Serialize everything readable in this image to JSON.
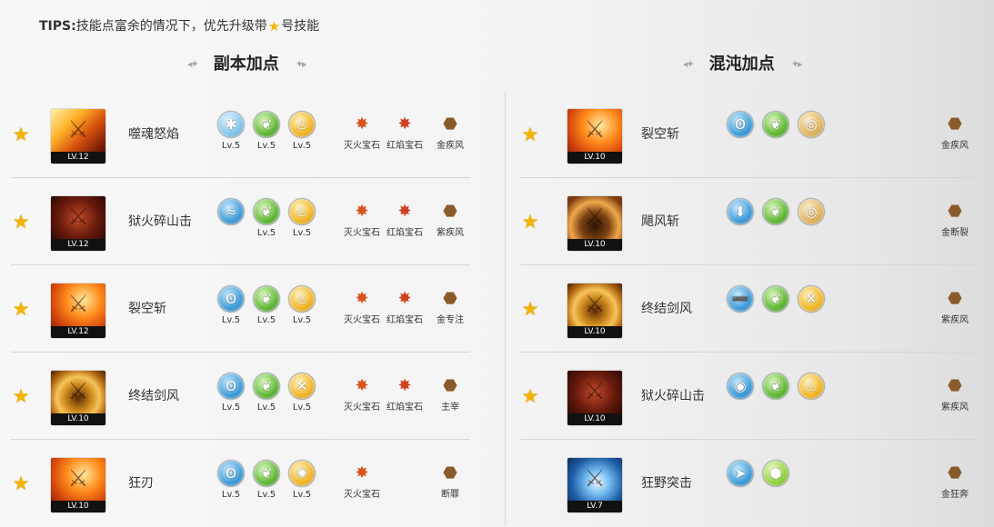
{
  "tips": {
    "prefix": "TIPS:",
    "text_before_star": "技能点富余的情况下，优先升级带",
    "star_icon": "star-icon",
    "text_after_star": "号技能"
  },
  "sections": {
    "left": {
      "title": "副本加点",
      "ornament": "◂⟡"
    },
    "right": {
      "title": "混沌加点",
      "ornament": "⟡▸"
    }
  },
  "left_rows": [
    {
      "starred": true,
      "skill_name": "噬魂怒焰",
      "level": "LV.12",
      "runes": [
        {
          "icon": "frost-rune-icon",
          "caption": "Lv.5"
        },
        {
          "icon": "leaf-rune-icon",
          "caption": "Lv.5"
        },
        {
          "icon": "flame-rune-icon",
          "caption": "Lv.5"
        }
      ],
      "gems": [
        {
          "icon": "fire-gem-icon",
          "caption": "灭火宝石"
        },
        {
          "icon": "red-gem-icon",
          "caption": "红焰宝石"
        },
        {
          "icon": "stone-icon",
          "caption": "金疾风"
        }
      ]
    },
    {
      "starred": true,
      "skill_name": "狱火碎山击",
      "level": "LV.12",
      "runes": [
        {
          "icon": "wave-rune-icon",
          "caption": ""
        },
        {
          "icon": "leaf-rune-icon",
          "caption": "Lv.5"
        },
        {
          "icon": "flame-rune-icon",
          "caption": "Lv.5"
        }
      ],
      "gems": [
        {
          "icon": "fire-gem-icon",
          "caption": "灭火宝石"
        },
        {
          "icon": "red-gem-icon",
          "caption": "红焰宝石"
        },
        {
          "icon": "stone-icon",
          "caption": "紫疾风"
        }
      ]
    },
    {
      "starred": true,
      "skill_name": "裂空斩",
      "level": "LV.12",
      "runes": [
        {
          "icon": "swirl-rune-icon",
          "caption": "Lv.5"
        },
        {
          "icon": "leaf-rune-icon",
          "caption": "Lv.5"
        },
        {
          "icon": "flame-rune-icon",
          "caption": "Lv.5"
        }
      ],
      "gems": [
        {
          "icon": "fire-gem-icon",
          "caption": "灭火宝石"
        },
        {
          "icon": "red-gem-icon",
          "caption": "红焰宝石"
        },
        {
          "icon": "stone-icon",
          "caption": "金专注"
        }
      ]
    },
    {
      "starred": true,
      "skill_name": "终结剑风",
      "level": "LV.10",
      "runes": [
        {
          "icon": "swirl-rune-icon",
          "caption": "Lv.5"
        },
        {
          "icon": "leaf-rune-icon",
          "caption": "Lv.5"
        },
        {
          "icon": "blade-rune-icon",
          "caption": "Lv.5"
        }
      ],
      "gems": [
        {
          "icon": "fire-gem-icon",
          "caption": "灭火宝石"
        },
        {
          "icon": "red-gem-icon",
          "caption": "红焰宝石"
        },
        {
          "icon": "stone-icon",
          "caption": "主宰"
        }
      ]
    },
    {
      "starred": true,
      "skill_name": "狂刃",
      "level": "LV.10",
      "runes": [
        {
          "icon": "swirl-rune-icon",
          "caption": "Lv.5"
        },
        {
          "icon": "leaf-rune-icon",
          "caption": "Lv.5"
        },
        {
          "icon": "burst-rune-icon",
          "caption": "Lv.5"
        }
      ],
      "gems": [
        {
          "icon": "fire-gem-icon",
          "caption": "灭火宝石"
        },
        {
          "icon": "none",
          "caption": ""
        },
        {
          "icon": "stone-icon",
          "caption": "断罪"
        }
      ]
    }
  ],
  "right_rows": [
    {
      "starred": true,
      "skill_name": "裂空斩",
      "level": "LV.10",
      "runes": [
        {
          "icon": "swirl-rune-icon",
          "caption": ""
        },
        {
          "icon": "leaf-rune-icon",
          "caption": ""
        },
        {
          "icon": "ring-rune-icon",
          "caption": ""
        }
      ],
      "gem": {
        "icon": "stone-icon",
        "caption": "金疾风"
      }
    },
    {
      "starred": true,
      "skill_name": "飓风斩",
      "level": "LV.10",
      "runes": [
        {
          "icon": "arrow-down-rune-icon",
          "caption": ""
        },
        {
          "icon": "leaf-rune-icon",
          "caption": ""
        },
        {
          "icon": "ring-rune-icon",
          "caption": ""
        }
      ],
      "gem": {
        "icon": "stone-icon",
        "caption": "金断裂"
      }
    },
    {
      "starred": true,
      "skill_name": "终结剑风",
      "level": "LV.10",
      "runes": [
        {
          "icon": "dash-rune-icon",
          "caption": ""
        },
        {
          "icon": "leaf-rune-icon",
          "caption": ""
        },
        {
          "icon": "blade-rune-icon",
          "caption": ""
        }
      ],
      "gem": {
        "icon": "stone-icon",
        "caption": "紫疾风"
      }
    },
    {
      "starred": true,
      "skill_name": "狱火碎山击",
      "level": "LV.10",
      "runes": [
        {
          "icon": "eye-rune-icon",
          "caption": ""
        },
        {
          "icon": "leaf-rune-icon",
          "caption": ""
        },
        {
          "icon": "flame-rune-icon",
          "caption": ""
        }
      ],
      "gem": {
        "icon": "stone-icon",
        "caption": "紫疾风"
      }
    },
    {
      "starred": false,
      "skill_name": "狂野突击",
      "level": "LV.7",
      "runes": [
        {
          "icon": "charge-rune-icon",
          "caption": ""
        },
        {
          "icon": "gem-rune-icon",
          "caption": ""
        }
      ],
      "gem": {
        "icon": "stone-icon",
        "caption": "金狂奔"
      }
    }
  ]
}
